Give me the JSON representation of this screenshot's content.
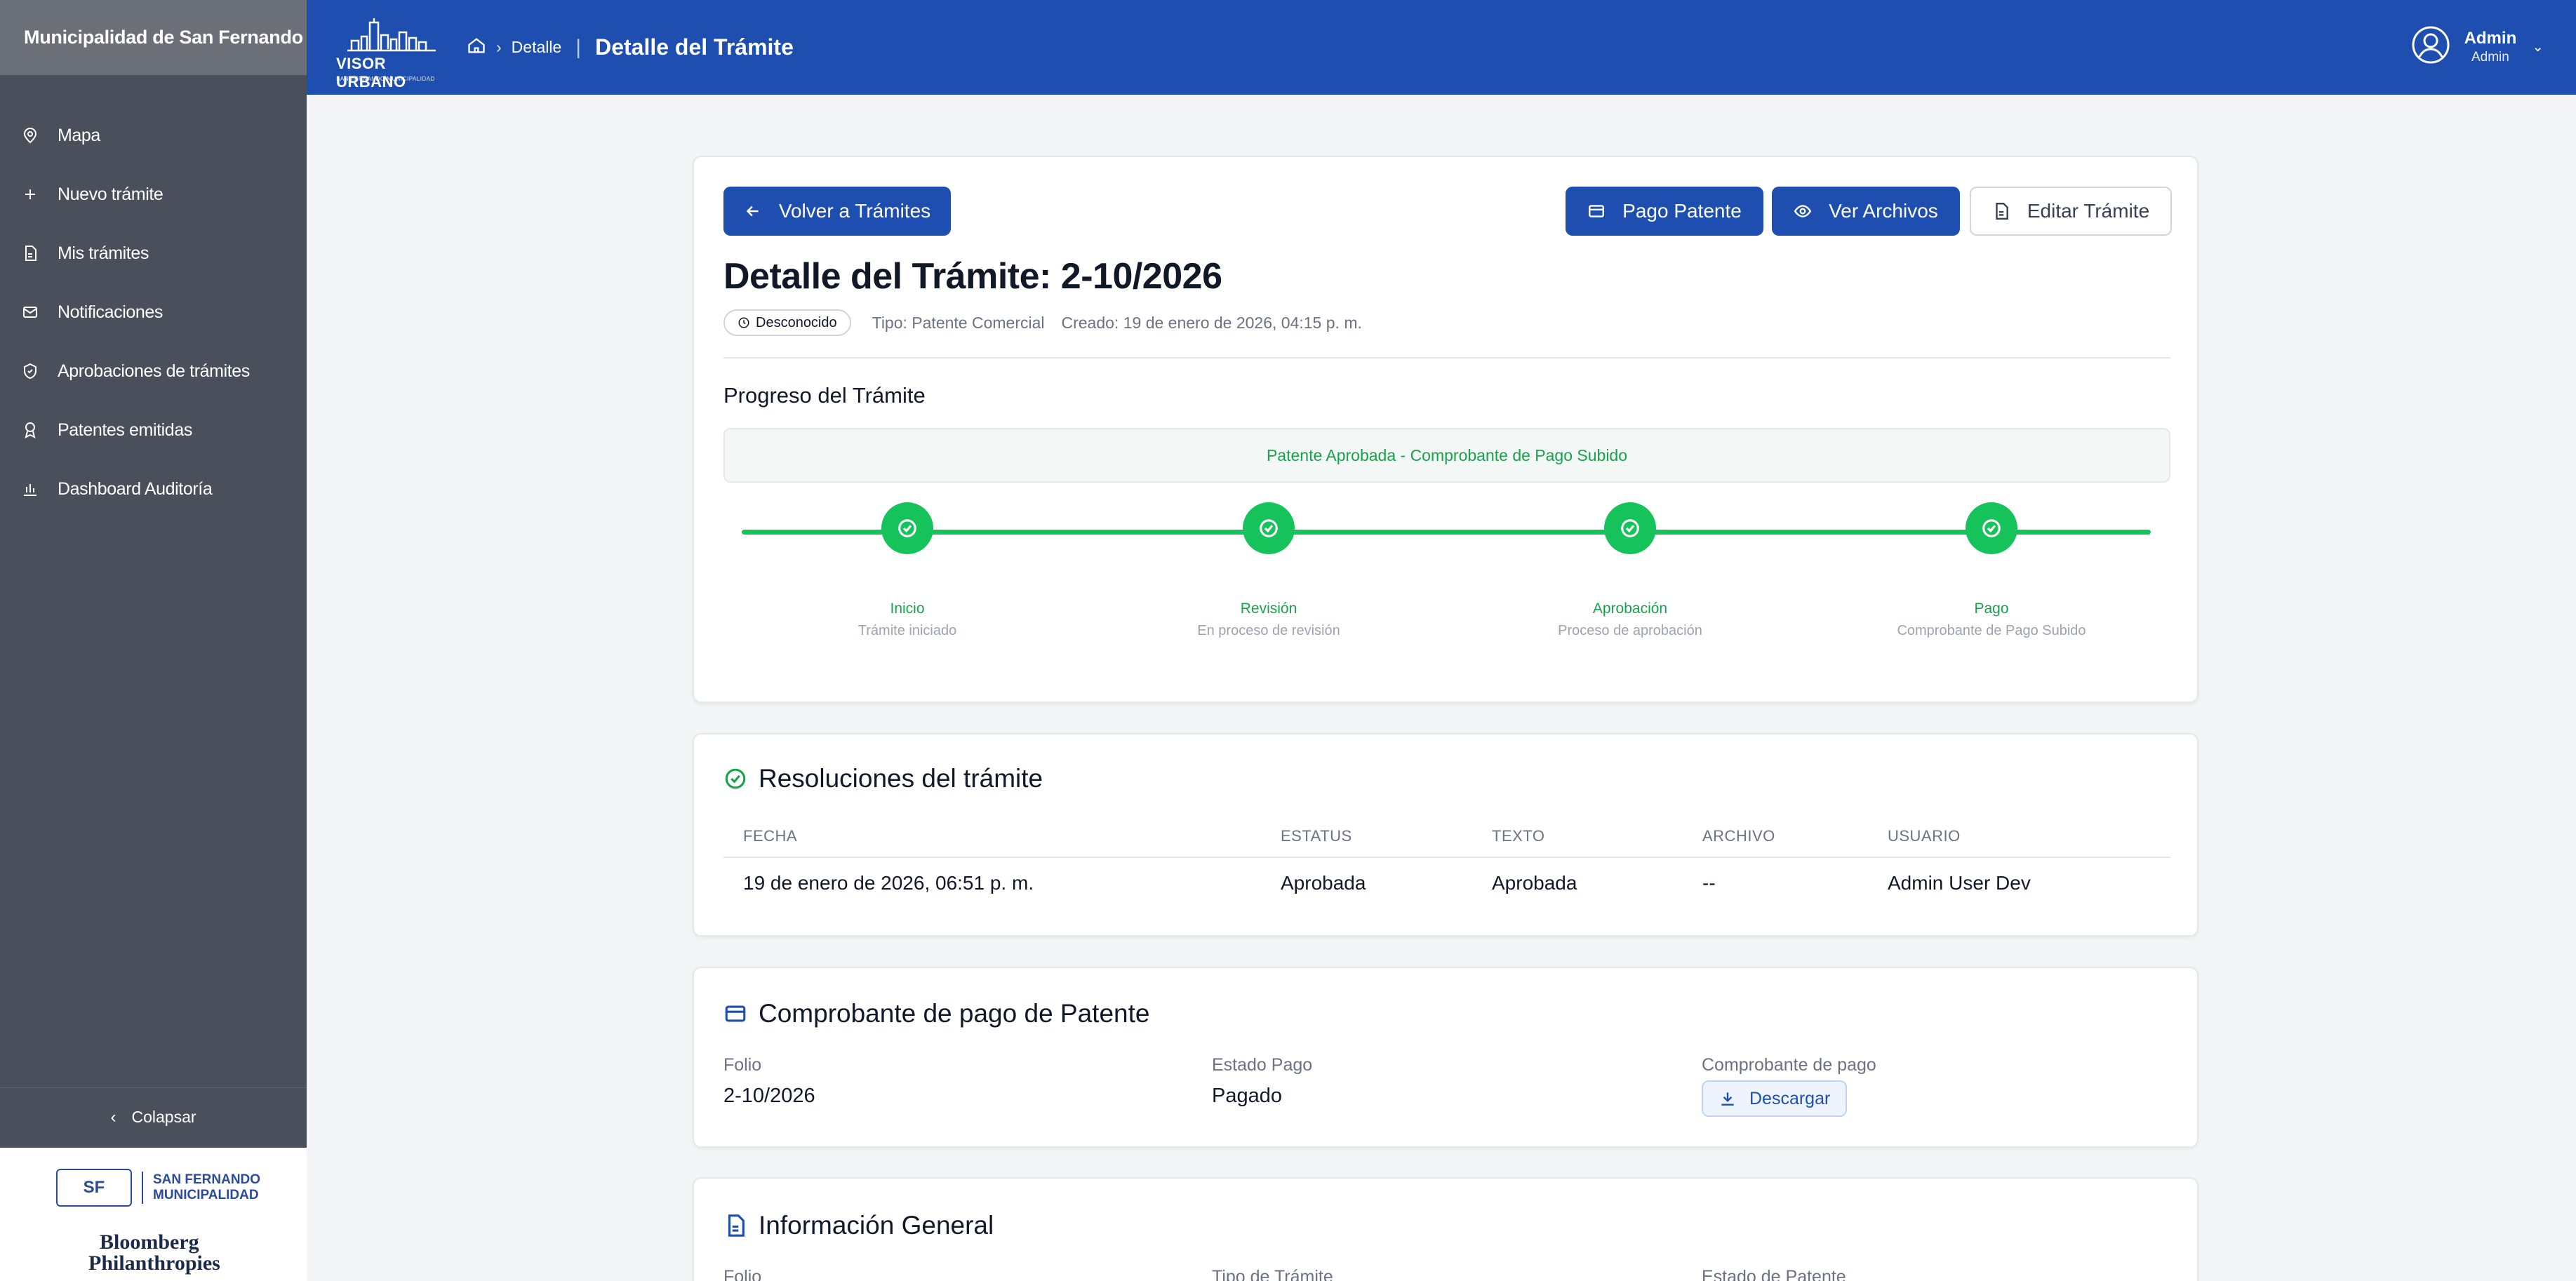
{
  "sidebar": {
    "org_name": "Municipalidad de San Fernando",
    "items": [
      {
        "label": "Mapa",
        "icon": "map-pin-icon"
      },
      {
        "label": "Nuevo trámite",
        "icon": "plus-icon"
      },
      {
        "label": "Mis trámites",
        "icon": "document-icon"
      },
      {
        "label": "Notificaciones",
        "icon": "mail-icon"
      },
      {
        "label": "Aprobaciones de trámites",
        "icon": "shield-check-icon"
      },
      {
        "label": "Patentes emitidas",
        "icon": "award-icon"
      },
      {
        "label": "Dashboard Auditoría",
        "icon": "bar-chart-icon"
      }
    ],
    "collapse_label": "Colapsar",
    "logo_sf_initials": "SF",
    "logo_sf_line1": "SAN FERNANDO",
    "logo_sf_line2": "MUNICIPALIDAD",
    "logo_bloomberg_line1": "Bloomberg",
    "logo_bloomberg_line2": "Philanthropies"
  },
  "topbar": {
    "brand_title": "VISOR URBANO",
    "brand_subtitle": "SAN FERNANDO MUNICIPALIDAD",
    "breadcrumb_detail": "Detalle",
    "breadcrumb_current": "Detalle del Trámite",
    "user_name": "Admin",
    "user_role": "Admin"
  },
  "detail": {
    "back_label": "Volver a Trámites",
    "pay_label": "Pago Patente",
    "files_label": "Ver Archivos",
    "edit_label": "Editar Trámite",
    "title": "Detalle del Trámite: 2-10/2026",
    "status_badge": "Desconocido",
    "type_text": "Tipo: Patente Comercial",
    "created_text": "Creado: 19 de enero de 2026, 04:15 p. m.",
    "progress_title": "Progreso del Trámite",
    "progress_status": "Patente Aprobada - Comprobante de Pago Subido",
    "steps": [
      {
        "label": "Inicio",
        "desc": "Trámite iniciado"
      },
      {
        "label": "Revisión",
        "desc": "En proceso de revisión"
      },
      {
        "label": "Aprobación",
        "desc": "Proceso de aprobación"
      },
      {
        "label": "Pago",
        "desc": "Comprobante de Pago Subido"
      }
    ]
  },
  "resolutions": {
    "title": "Resoluciones del trámite",
    "headers": [
      "FECHA",
      "ESTATUS",
      "TEXTO",
      "ARCHIVO",
      "USUARIO"
    ],
    "rows": [
      [
        "19 de enero de 2026, 06:51 p. m.",
        "Aprobada",
        "Aprobada",
        "--",
        "Admin User Dev"
      ]
    ]
  },
  "payment": {
    "title": "Comprobante de pago de Patente",
    "folio_label": "Folio",
    "folio_value": "2-10/2026",
    "estado_label": "Estado Pago",
    "estado_value": "Pagado",
    "comprobante_label": "Comprobante de pago",
    "download_label": "Descargar"
  },
  "general": {
    "title": "Información General",
    "folio_label": "Folio",
    "tipo_label": "Tipo de Trámite",
    "estado_label": "Estado de Patente"
  },
  "colors": {
    "primary": "#1e4fb0",
    "success": "#16c35a",
    "sidebar": "#4a4f5c"
  }
}
